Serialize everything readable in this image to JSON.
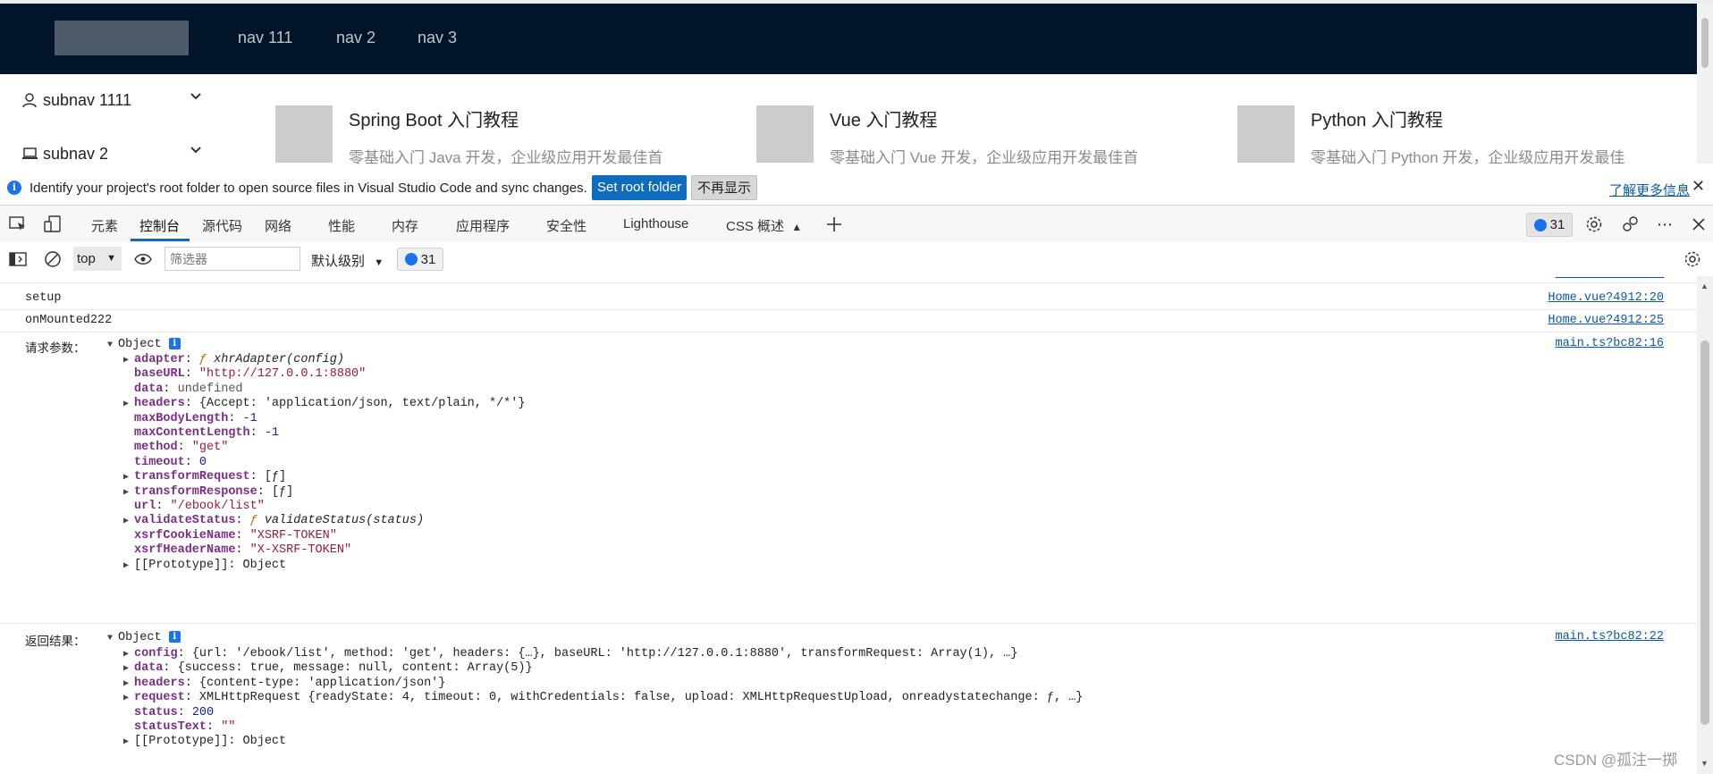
{
  "nav": {
    "items": [
      "nav 111",
      "nav 2",
      "nav 3"
    ]
  },
  "subnav": {
    "items": [
      "subnav 1111",
      "subnav 2"
    ]
  },
  "cards": [
    {
      "title": "Spring Boot 入门教程",
      "desc": "零基础入门 Java 开发，企业级应用开发最佳首"
    },
    {
      "title": "Vue 入门教程",
      "desc": "零基础入门 Vue 开发，企业级应用开发最佳首"
    },
    {
      "title": "Python 入门教程",
      "desc": "零基础入门 Python 开发，企业级应用开发最佳"
    }
  ],
  "infobar": {
    "message": "Identify your project's root folder to open source files in Visual Studio Code and sync changes.",
    "set_root": "Set root folder",
    "dismiss": "不再显示",
    "learn_more": "了解更多信息"
  },
  "devtools": {
    "tabs": [
      "元素",
      "控制台",
      "源代码",
      "网络",
      "性能",
      "内存",
      "应用程序",
      "安全性",
      "Lighthouse",
      "CSS 概述"
    ],
    "message_count": "31"
  },
  "console_toolbar": {
    "context": "top",
    "filter_placeholder": "筛选器",
    "level": "默认级别",
    "message_count": "31"
  },
  "console": {
    "rows": [
      {
        "msg": "setup",
        "source": "Home.vue?4912:20"
      },
      {
        "msg": "onMounted222",
        "source": "Home.vue?4912:25"
      }
    ],
    "request": {
      "label": "请求参数：",
      "source": "main.ts?bc82:16",
      "obj": "Object",
      "props": [
        {
          "key": "adapter",
          "value": "xhrAdapter(config)",
          "type": "fn",
          "expand": true
        },
        {
          "key": "baseURL",
          "value": "\"http://127.0.0.1:8880\"",
          "type": "str",
          "expand": false
        },
        {
          "key": "data",
          "value": "undefined",
          "type": "dim",
          "expand": false
        },
        {
          "key": "headers",
          "value": "{Accept: 'application/json, text/plain, */*'}",
          "type": "obj",
          "expand": true
        },
        {
          "key": "maxBodyLength",
          "value": "-1",
          "type": "num",
          "expand": false
        },
        {
          "key": "maxContentLength",
          "value": "-1",
          "type": "num",
          "expand": false
        },
        {
          "key": "method",
          "value": "\"get\"",
          "type": "str",
          "expand": false
        },
        {
          "key": "timeout",
          "value": "0",
          "type": "num",
          "expand": false
        },
        {
          "key": "transformRequest",
          "value": "[ƒ]",
          "type": "obj",
          "expand": true
        },
        {
          "key": "transformResponse",
          "value": "[ƒ]",
          "type": "obj",
          "expand": true
        },
        {
          "key": "url",
          "value": "\"/ebook/list\"",
          "type": "str",
          "expand": false
        },
        {
          "key": "validateStatus",
          "value": "validateStatus(status)",
          "type": "fn",
          "expand": true
        },
        {
          "key": "xsrfCookieName",
          "value": "\"XSRF-TOKEN\"",
          "type": "str",
          "expand": false
        },
        {
          "key": "xsrfHeaderName",
          "value": "\"X-XSRF-TOKEN\"",
          "type": "str",
          "expand": false
        },
        {
          "key": "[[Prototype]]",
          "value": "Object",
          "type": "obj",
          "expand": true,
          "proto": true
        }
      ]
    },
    "response": {
      "label": "返回结果：",
      "source": "main.ts?bc82:22",
      "obj": "Object",
      "props": [
        {
          "key": "config",
          "value": "{url: '/ebook/list', method: 'get', headers: {…}, baseURL: 'http://127.0.0.1:8880', transformRequest: Array(1), …}",
          "type": "obj",
          "expand": true
        },
        {
          "key": "data",
          "value": "{success: true, message: null, content: Array(5)}",
          "type": "obj",
          "expand": true
        },
        {
          "key": "headers",
          "value": "{content-type: 'application/json'}",
          "type": "obj",
          "expand": true
        },
        {
          "key": "request",
          "value": "XMLHttpRequest {readyState: 4, timeout: 0, withCredentials: false, upload: XMLHttpRequestUpload, onreadystatechange: ƒ, …}",
          "type": "obj",
          "expand": true
        },
        {
          "key": "status",
          "value": "200",
          "type": "num",
          "expand": false
        },
        {
          "key": "statusText",
          "value": "\"\"",
          "type": "str",
          "expand": false
        },
        {
          "key": "[[Prototype]]",
          "value": "Object",
          "type": "obj",
          "expand": true,
          "proto": true
        }
      ]
    }
  },
  "watermark": "CSDN @孤注一掷",
  "colors": {
    "header_bg": "#001529",
    "accent": "#0f6cbd",
    "string": "#9b1c31",
    "number": "#1a1aa6",
    "key": "#7b2d86"
  }
}
